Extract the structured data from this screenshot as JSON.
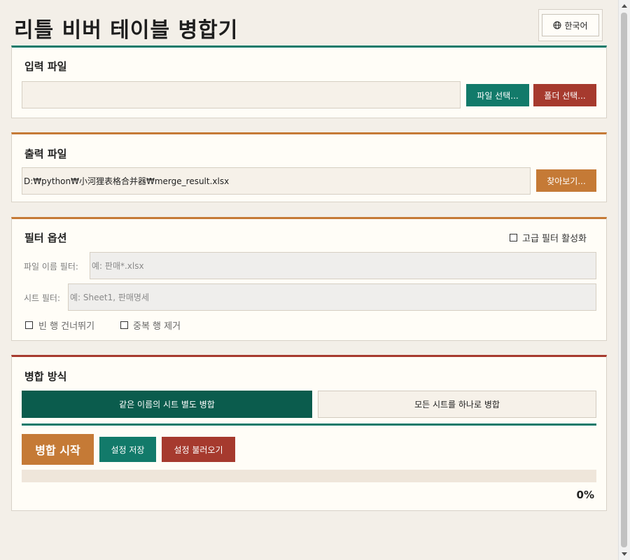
{
  "app": {
    "title": "리틀 비버 테이블 병합기",
    "language_label": "한국어"
  },
  "input_section": {
    "title": "입력 파일",
    "path_value": "",
    "file_button": "파일 선택...",
    "folder_button": "폴더 선택..."
  },
  "output_section": {
    "title": "출력 파일",
    "path_value": "D:₩python₩小河狸表格合并器₩merge_result.xlsx",
    "browse_button": "찾아보기..."
  },
  "filter_section": {
    "title": "필터 옵션",
    "advanced_toggle_label": "고급 필터 활성화",
    "advanced_enabled": false,
    "filename_filter_label": "파일 이름 필터:",
    "filename_filter_placeholder": "예: 판매*.xlsx",
    "sheet_filter_label": "시트 필터:",
    "sheet_filter_placeholder": "예: Sheet1, 판매명세",
    "skip_empty_rows_label": "빈 행 건너뛰기",
    "skip_empty_rows": false,
    "remove_duplicates_label": "중복 행 제거",
    "remove_duplicates": false
  },
  "merge_section": {
    "title": "병합 방식",
    "modes": [
      {
        "label": "같은 이름의 시트 별도 병합",
        "selected": true
      },
      {
        "label": "모든 시트를 하나로 병합",
        "selected": false
      }
    ],
    "start_button": "병합 시작",
    "save_settings_button": "설정 저장",
    "load_settings_button": "설정 불러오기",
    "progress": 0,
    "progress_text": "0%"
  },
  "colors": {
    "teal": "#127a6a",
    "dark_green": "#0b5c4d",
    "red": "#a63a2e",
    "orange": "#c57a36",
    "background": "#f3efe8"
  }
}
